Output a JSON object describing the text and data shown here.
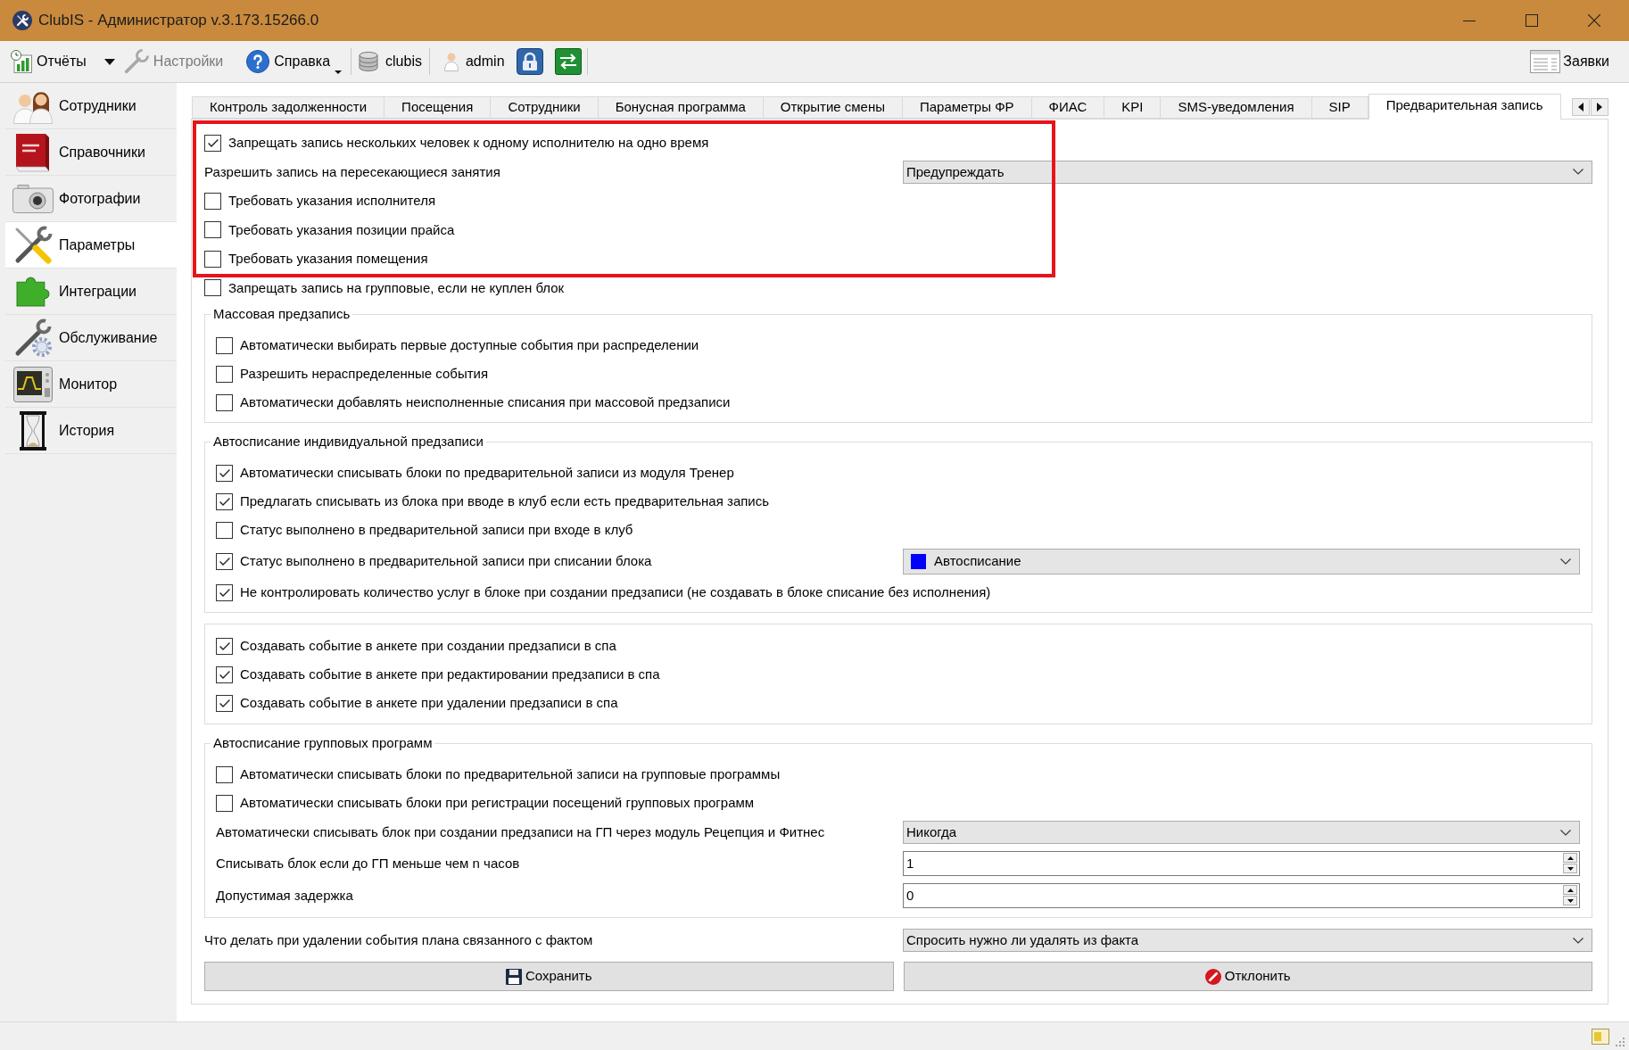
{
  "window": {
    "title": "ClubIS - Администратор v.3.173.15266.0"
  },
  "toolbar": {
    "buttons": [
      {
        "kind": "split",
        "label": "Отчёты",
        "disabled": false
      },
      {
        "kind": "plain",
        "label": "Настройки",
        "disabled": true
      },
      {
        "kind": "dropdown",
        "label": "Справка",
        "disabled": false
      }
    ],
    "database": "clubis",
    "user": "admin",
    "right_button": {
      "label": "Заявки"
    }
  },
  "sidebar": {
    "items": [
      {
        "label": "Сотрудники",
        "selected": false
      },
      {
        "label": "Справочники",
        "selected": false
      },
      {
        "label": "Фотографии",
        "selected": false
      },
      {
        "label": "Параметры",
        "selected": true
      },
      {
        "label": "Интеграции",
        "selected": false
      },
      {
        "label": "Обслуживание",
        "selected": false
      },
      {
        "label": "Монитор",
        "selected": false
      },
      {
        "label": "История",
        "selected": false
      }
    ]
  },
  "tabs": [
    {
      "label": "Контроль задолженности",
      "selected": false
    },
    {
      "label": "Посещения",
      "selected": false
    },
    {
      "label": "Сотрудники",
      "selected": false
    },
    {
      "label": "Бонусная программа",
      "selected": false
    },
    {
      "label": "Открытие смены",
      "selected": false
    },
    {
      "label": "Параметры ФР",
      "selected": false
    },
    {
      "label": "ФИАС",
      "selected": false
    },
    {
      "label": "KPI",
      "selected": false
    },
    {
      "label": "SMS-уведомления",
      "selected": false
    },
    {
      "label": "SIP",
      "selected": false
    },
    {
      "label": "Предварительная запись",
      "selected": true
    }
  ],
  "form": {
    "rows": [
      {
        "kind": "checkbox",
        "label": "Запрещать запись нескольких человек к одному исполнителю на одно время",
        "checked": true,
        "highlighted": true
      },
      {
        "kind": "select",
        "label": "Разрешить запись на пересекающиеся занятия",
        "value": "Предупреждать",
        "highlighted": true
      },
      {
        "kind": "checkbox",
        "label": "Требовать указания исполнителя",
        "checked": false,
        "highlighted": true
      },
      {
        "kind": "checkbox",
        "label": "Требовать указания позиции прайса",
        "checked": false,
        "highlighted": true
      },
      {
        "kind": "checkbox",
        "label": "Требовать указания помещения",
        "checked": false,
        "highlighted": true
      },
      {
        "kind": "checkbox",
        "label": "Запрещать запись на групповые, если не куплен блок",
        "checked": false,
        "highlighted": false
      }
    ],
    "groups": [
      {
        "title": "Массовая предзапись",
        "rows": [
          {
            "kind": "checkbox",
            "label": "Автоматически выбирать первые доступные события при распределении",
            "checked": false
          },
          {
            "kind": "checkbox",
            "label": "Разрешить нераспределенные события",
            "checked": false
          },
          {
            "kind": "checkbox",
            "label": "Автоматически добавлять неисполненные списания при массовой предзаписи",
            "checked": false
          }
        ]
      },
      {
        "title": "Автосписание индивидуальной предзаписи",
        "rows": [
          {
            "kind": "checkbox",
            "label": "Автоматически списывать блоки по предварительной записи из модуля Тренер",
            "checked": true
          },
          {
            "kind": "checkbox",
            "label": "Предлагать списывать из блока при вводе в клуб если есть предварительная запись",
            "checked": true
          },
          {
            "kind": "checkbox",
            "label": "Статус выполнено в предварительной записи при входе в клуб",
            "checked": false
          },
          {
            "kind": "checkbox_select",
            "label": "Статус выполнено в предварительной записи при списании блока",
            "checked": true,
            "value": "Автосписание",
            "color": "#0000ff"
          },
          {
            "kind": "checkbox",
            "label": "Не контролировать количество услуг в блоке при создании предзаписи (не создавать в блоке списание без исполнения)",
            "checked": true
          }
        ]
      },
      {
        "rows": [
          {
            "kind": "checkbox",
            "label": "Создавать событие в анкете при создании предзаписи в спа",
            "checked": true
          },
          {
            "kind": "checkbox",
            "label": "Создавать событие в анкете при редактировании предзаписи в спа",
            "checked": true
          },
          {
            "kind": "checkbox",
            "label": "Создавать событие в анкете при удалении предзаписи в спа",
            "checked": true
          }
        ]
      },
      {
        "title": "Автосписание групповых программ",
        "rows": [
          {
            "kind": "checkbox",
            "label": "Автоматически списывать блоки по предварительной записи на групповые программы",
            "checked": false
          },
          {
            "kind": "checkbox",
            "label": "Автоматически списывать блоки при регистрации посещений групповых программ",
            "checked": false
          },
          {
            "kind": "select",
            "label": "Автоматически списывать блок при создании предзаписи на ГП через модуль Рецепция и Фитнес",
            "value": "Никогда"
          },
          {
            "kind": "spin",
            "label": "Списывать блок если до ГП меньше чем n часов",
            "value": "1"
          },
          {
            "kind": "spin",
            "label": "Допустимая задержка",
            "value": "0"
          }
        ]
      }
    ],
    "footer_rows": [
      {
        "kind": "select",
        "label": "Что делать при удалении события плана связанного с фактом",
        "value": "Спросить нужно ли удалять из факта"
      }
    ],
    "buttons": [
      {
        "kind": "save",
        "label": "Сохранить"
      },
      {
        "kind": "cancel",
        "label": "Отклонить"
      }
    ]
  }
}
